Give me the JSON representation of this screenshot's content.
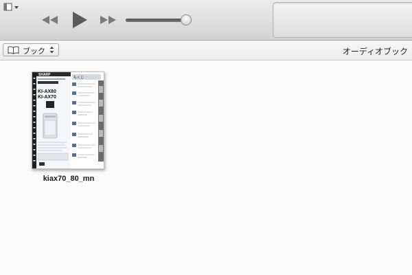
{
  "toolbar": {
    "sidebar_toggle_icon": "sidebar-toggle-icon",
    "prev_icon": "rewind-icon",
    "play_icon": "play-icon",
    "next_icon": "fast-forward-icon",
    "volume_level": 0.9
  },
  "subbar": {
    "media_popup_label": "ブック",
    "media_popup_icon": "book-icon",
    "section_title": "オーディオブック"
  },
  "library": {
    "items": [
      {
        "title": "kiax70_80_mn",
        "cover": {
          "brand": "SHARP",
          "models": [
            "KI-AX80",
            "KI-AX70"
          ],
          "heading": "もくじ"
        }
      }
    ]
  },
  "colors": {
    "toolbar_top": "#ececec",
    "toolbar_bottom": "#d2d2d2",
    "content_bg": "#fafafa",
    "cover_dark": "#2b2b2b",
    "cover_blue": "#5a6f8f"
  }
}
